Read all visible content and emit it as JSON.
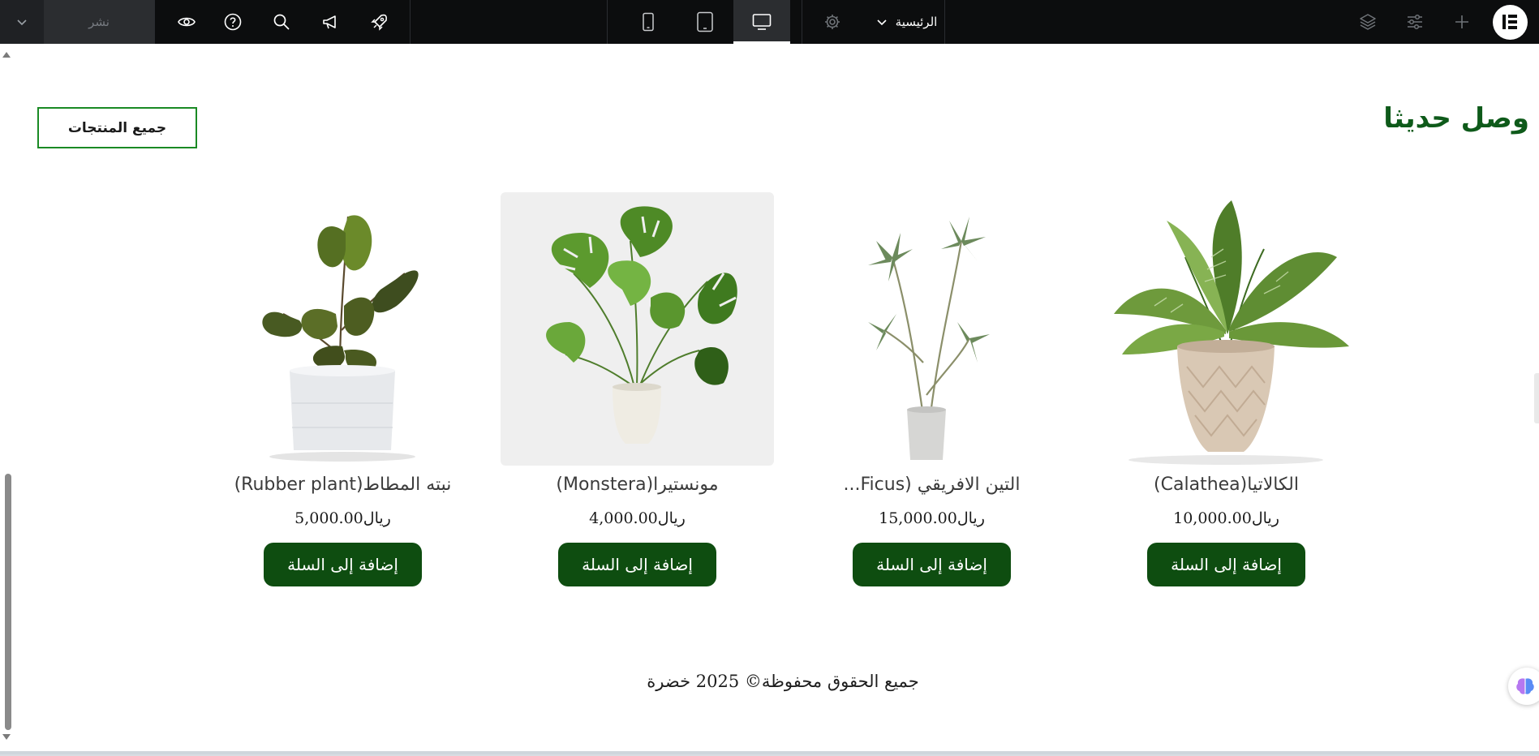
{
  "toolbar": {
    "publish_label": "نشر",
    "page_select_label": "الرئيسية",
    "icons": [
      "chevron-down-icon",
      "eye-icon",
      "help-icon",
      "search-icon",
      "megaphone-icon",
      "rocket-icon",
      "mobile-icon",
      "tablet-icon",
      "desktop-icon",
      "gear-icon",
      "chevron-down-icon",
      "layers-icon",
      "sliders-icon",
      "plus-icon",
      "elementor-logo"
    ],
    "active_device": "desktop"
  },
  "section": {
    "title": "وصل حديثا",
    "all_products_label": "جميع المنتجات"
  },
  "products": [
    {
      "name": "الكالاتيا(Calathea)",
      "price": "10,000.00ريال",
      "button": "إضافة إلى السلة"
    },
    {
      "name": "التين الافريقي (Ficus...",
      "price": "15,000.00ريال",
      "button": "إضافة إلى السلة"
    },
    {
      "name": "مونستيرا(Monstera)",
      "price": "4,000.00ريال",
      "button": "إضافة إلى السلة"
    },
    {
      "name": "نبته المطاط(Rubber plant)",
      "price": "5,000.00ريال",
      "button": "إضافة إلى السلة"
    }
  ],
  "footer": {
    "copyright": "جميع الحقوق محفوظة© 2025 خضرة"
  },
  "colors": {
    "title_green": "#0e5a1a",
    "button_green": "#0e4d10",
    "outline_green": "#1a8a24",
    "toolbar_bg": "#0c0d0e"
  }
}
